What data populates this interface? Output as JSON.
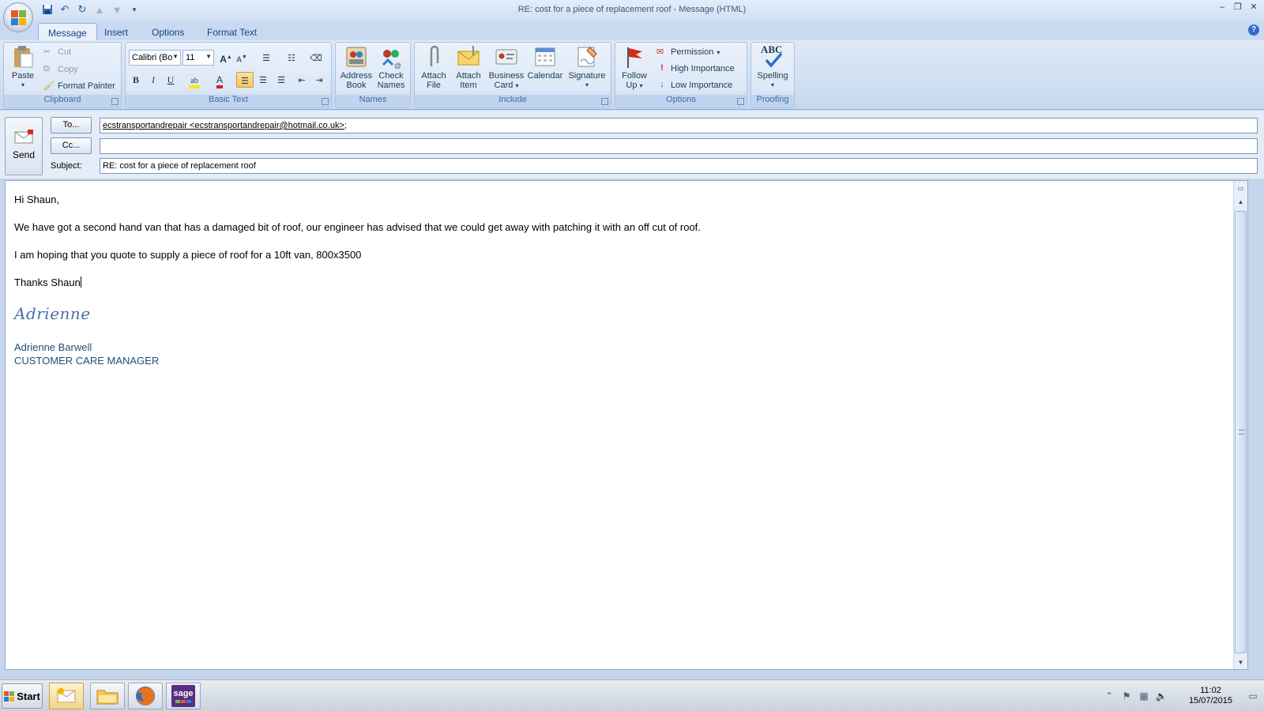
{
  "window": {
    "title": "RE: cost for a piece of replacement roof  - Message (HTML)"
  },
  "tabs": [
    "Message",
    "Insert",
    "Options",
    "Format Text"
  ],
  "ribbon": {
    "clipboard": {
      "label": "Clipboard",
      "paste": "Paste",
      "cut": "Cut",
      "copy": "Copy",
      "format_painter": "Format Painter"
    },
    "basic_text": {
      "label": "Basic Text",
      "font": "Calibri (Bo",
      "size": "11",
      "bold": "B",
      "italic": "I",
      "underline": "U",
      "grow": "A",
      "shrink": "A",
      "font_color": "A"
    },
    "names": {
      "label": "Names",
      "address_book_1": "Address",
      "address_book_2": "Book",
      "check_names_1": "Check",
      "check_names_2": "Names"
    },
    "include": {
      "label": "Include",
      "attach_file_1": "Attach",
      "attach_file_2": "File",
      "attach_item_1": "Attach",
      "attach_item_2": "Item",
      "business_card_1": "Business",
      "business_card_2": "Card",
      "calendar": "Calendar",
      "signature": "Signature"
    },
    "options": {
      "label": "Options",
      "follow_up_1": "Follow",
      "follow_up_2": "Up",
      "permission": "Permission",
      "high_importance": "High Importance",
      "low_importance": "Low Importance"
    },
    "proofing": {
      "label": "Proofing",
      "spelling": "Spelling",
      "abc": "ABC"
    }
  },
  "header": {
    "send": "Send",
    "to_button": "To...",
    "cc_button": "Cc...",
    "subject_label": "Subject:",
    "to_value": "ecstransportandrepair <ecstransportandrepair@hotmail.co.uk>",
    "to_suffix": ";",
    "cc_value": "",
    "subject_value": "RE: cost for a piece of replacement roof"
  },
  "body": {
    "greeting": "Hi Shaun,",
    "para1": "We have got a second hand van that has a damaged bit of roof, our engineer has advised that we could get away with patching it with an off cut of roof.",
    "para2": "I am hoping that you quote to supply a piece of roof for a 10ft van, 800x3500",
    "closing": "Thanks Shaun",
    "signature_script": "Adrienne",
    "signature_name": "Adrienne Barwell",
    "signature_title": "CUSTOMER CARE MANAGER"
  },
  "taskbar": {
    "start": "Start",
    "time": "11:02",
    "date": "15/07/2015",
    "sage": "sage"
  },
  "colors": {
    "ribbon_bg": "#dfe9f6",
    "tab_text": "#15428b",
    "signature_blue": "#1f4e79"
  }
}
